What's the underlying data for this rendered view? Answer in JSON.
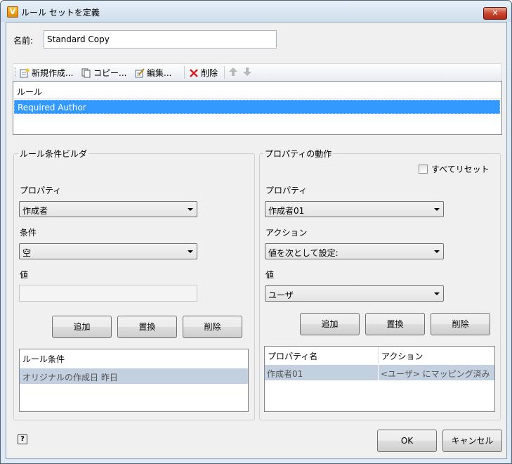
{
  "window": {
    "title": "ルール セットを定義",
    "close_icon": "✕"
  },
  "name_field": {
    "label": "名前:",
    "value": "Standard Copy"
  },
  "toolbar": {
    "new_label": "新規作成...",
    "copy_label": "コピー...",
    "edit_label": "編集...",
    "delete_label": "削除"
  },
  "rules_list": {
    "header": "ルール",
    "items": [
      "Required Author"
    ]
  },
  "condition_builder": {
    "title": "ルール条件ビルダ",
    "property_label": "プロパティ",
    "property_value": "作成者",
    "condition_label": "条件",
    "condition_value": "空",
    "value_label": "値",
    "value_value": "",
    "add_label": "追加",
    "replace_label": "置換",
    "delete_label": "削除",
    "list_header": "ルール条件",
    "conditions": [
      "オリジナルの作成日 昨日"
    ]
  },
  "property_actions": {
    "title": "プロパティの動作",
    "reset_all_label": "すべてリセット",
    "reset_all_checked": false,
    "property_label": "プロパティ",
    "property_value": "作成者01",
    "action_label": "アクション",
    "action_value": "値を次として設定:",
    "value_label": "値",
    "value_value": "ユーザ",
    "add_label": "追加",
    "replace_label": "置換",
    "delete_label": "削除",
    "grid_headers": [
      "プロパティ名",
      "アクション"
    ],
    "rows": [
      {
        "property": "作成者01",
        "action": "<ユーザ> にマッピング済み"
      }
    ]
  },
  "footer": {
    "help_icon": "?",
    "ok_label": "OK",
    "cancel_label": "キャンセル"
  },
  "colors": {
    "selection": "#3399ff",
    "row_highlight": "#c2d0df",
    "close_button": "#c8472f"
  }
}
